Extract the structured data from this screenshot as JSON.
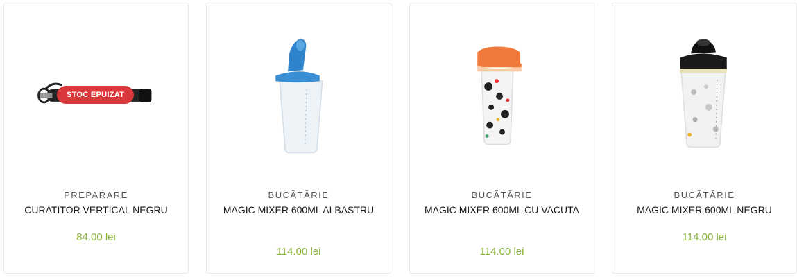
{
  "products": [
    {
      "category": "PREPARARE",
      "title": "CURATITOR VERTICAL NEGRU",
      "price": "84.00 lei",
      "badge": "STOC EPUIZAT",
      "image": "black-tool-image"
    },
    {
      "category": "BUCĂTĂRIE",
      "title": "MAGIC MIXER 600ML ALBASTRU",
      "price": "114.00 lei",
      "image": "blue-shaker-image"
    },
    {
      "category": "BUCĂTĂRIE",
      "title": "MAGIC MIXER 600ML CU VACUTA",
      "price": "114.00 lei",
      "image": "cow-print-shaker-image"
    },
    {
      "category": "BUCĂTĂRIE",
      "title": "MAGIC MIXER 600ML NEGRU",
      "price": "114.00 lei",
      "image": "black-shaker-image"
    }
  ],
  "colors": {
    "price": "#8ab33a",
    "badge": "#d9383a",
    "blue_lid": "#3a8fd4",
    "orange_lid": "#f07a3c",
    "black_lid": "#1a1a1a"
  }
}
